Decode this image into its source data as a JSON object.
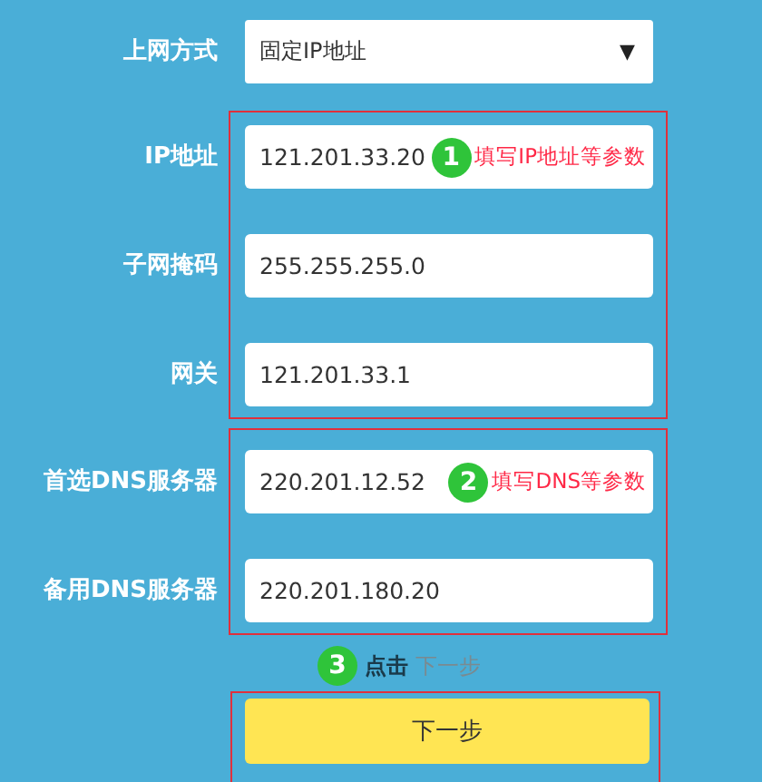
{
  "connection_type": {
    "label": "上网方式",
    "value": "固定IP地址",
    "caret": "▼"
  },
  "groups": [
    {
      "fields": [
        {
          "label": "IP地址",
          "value": "121.201.33.20",
          "annotation": {
            "number": "1",
            "text": "填写IP地址等参数"
          }
        },
        {
          "label": "子网掩码",
          "value": "255.255.255.0"
        },
        {
          "label": "网关",
          "value": "121.201.33.1"
        }
      ]
    },
    {
      "fields": [
        {
          "label": "首选DNS服务器",
          "value": "220.201.12.52",
          "annotation": {
            "number": "2",
            "text": "填写DNS等参数"
          }
        },
        {
          "label": "备用DNS服务器",
          "value": "220.201.180.20"
        }
      ]
    }
  ],
  "step_hint": {
    "number": "3",
    "text": "点击",
    "target": "下一步"
  },
  "next_button": {
    "label": "下一步"
  }
}
